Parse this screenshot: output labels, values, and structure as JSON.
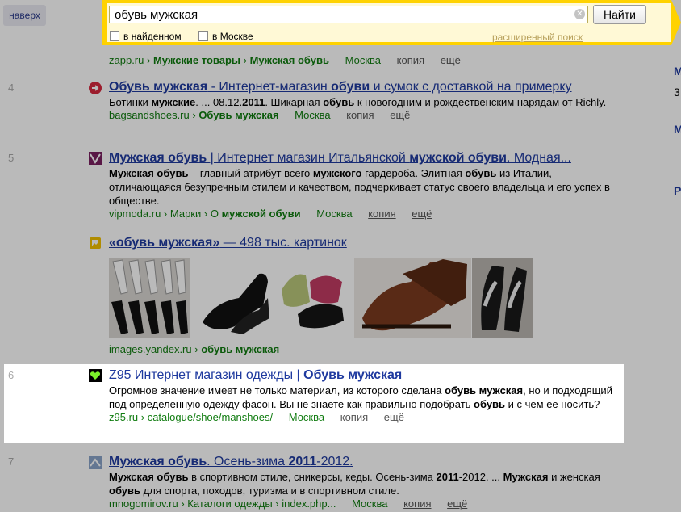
{
  "top_button": "наверх",
  "search": {
    "query": "обувь мужская",
    "button": "Найти",
    "check_found": "в найденном",
    "check_city": "в Москве",
    "advanced": "расширенный поиск"
  },
  "prev_result": {
    "url": "zapp.ru",
    "path": "Мужские товары",
    "path2": "Мужская обувь",
    "city": "Москва",
    "copy": "копия",
    "more": "ещё"
  },
  "results": [
    {
      "num": "4",
      "title_a": "Обувь мужская",
      "title_b": " - Интернет-магазин ",
      "title_c": "обуви",
      "title_d": " и сумок с доставкой на примерку",
      "snippet_a": "Ботинки ",
      "snippet_b": "мужские",
      "snippet_c": ". ... 08.12.",
      "snippet_d": "2011",
      "snippet_e": ". Шикарная ",
      "snippet_f": "обувь",
      "snippet_g": " к новогодним и рождественским нарядам от Richly.",
      "url": "bagsandshoes.ru",
      "path": "Обувь мужская",
      "city": "Москва",
      "copy": "копия",
      "more": "ещё"
    },
    {
      "num": "5",
      "title_a": "Мужская обувь",
      "title_b": " | Интернет магазин Итальянской ",
      "title_c": "мужской обуви",
      "title_d": ". Модная...",
      "snippet_a": "Мужская обувь",
      "snippet_b": " – главный атрибут всего ",
      "snippet_c": "мужского",
      "snippet_d": " гардероба. Элитная ",
      "snippet_e": "обувь",
      "snippet_f": " из Италии, отличающаяся безупречным стилем и качеством, подчеркивает статус своего владельца и его успех в обществе.",
      "url": "vipmoda.ru",
      "path": "Марки",
      "path2": "О ",
      "path3": "мужской обуви",
      "city": "Москва",
      "copy": "копия",
      "more": "ещё"
    },
    {
      "num": "6",
      "title_a": "Z95 Интернет магазин одежды | ",
      "title_b": "Обувь мужская",
      "snippet_a": "Огромное значение имеет не только материал, из которого сделана ",
      "snippet_b": "обувь мужская",
      "snippet_c": ", но и подходящий под определенную одежду фасон. Вы не знаете как правильно подобрать ",
      "snippet_d": "обувь",
      "snippet_e": " и с чем ее носить?",
      "url": "z95.ru",
      "path": "catalogue/shoe/manshoes/",
      "city": "Москва",
      "copy": "копия",
      "more": "ещё"
    },
    {
      "num": "7",
      "title_a": "Мужская обувь",
      "title_b": ". Осень-зима ",
      "title_c": "2011",
      "title_d": "-2012.",
      "snippet_a": "Мужская обувь",
      "snippet_b": " в спортивном стиле, сникерсы, кеды. Осень-зима ",
      "snippet_c": "2011",
      "snippet_d": "-2012. ... ",
      "snippet_e": "Мужская",
      "snippet_f": " и женская ",
      "snippet_g": "обувь",
      "snippet_h": " для спорта, походов, туризма и в спортивном стиле.",
      "url": "mnogomirov.ru",
      "path": "Каталоги одежды",
      "path2": "index.php...",
      "city": "Москва",
      "copy": "копия",
      "more": "ещё"
    }
  ],
  "images": {
    "title_a": "«обувь мужская»",
    "title_b": " — 498 тыс. картинок",
    "url": "images.yandex.ru",
    "path": "обувь мужская"
  },
  "right_letters": [
    "M",
    "3",
    "M",
    "P"
  ]
}
